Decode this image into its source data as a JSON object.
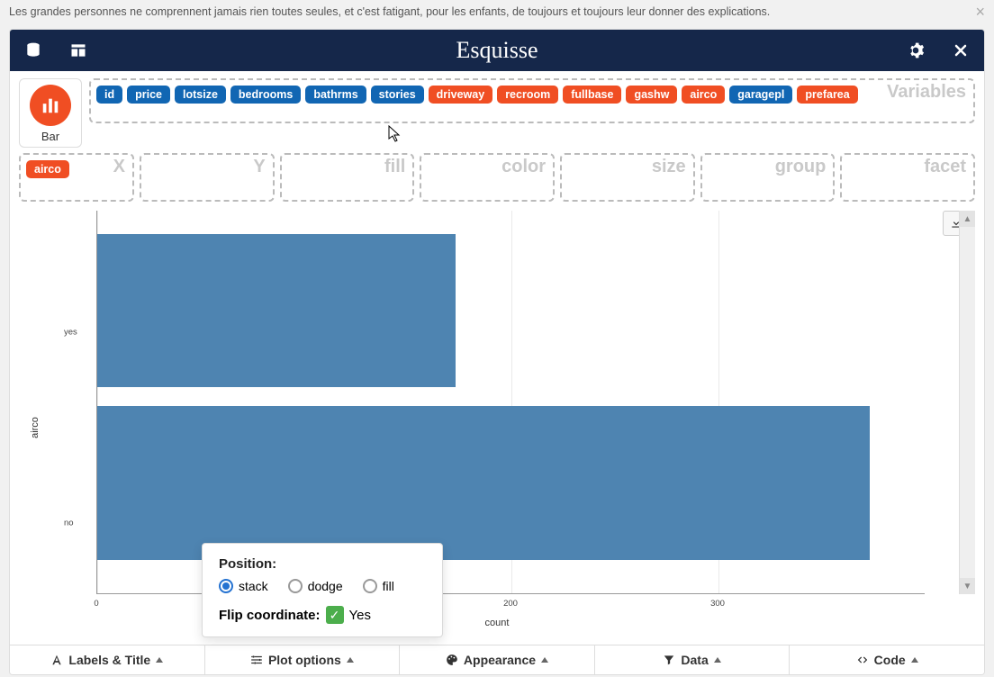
{
  "quote": "Les grandes personnes ne comprennent jamais rien toutes seules, et c'est fatigant, pour les enfants, de toujours et toujours leur donner des explications.",
  "brand": "Esquisse",
  "geom": {
    "label": "Bar"
  },
  "zones": {
    "variables_title": "Variables",
    "titles": {
      "x": "X",
      "y": "Y",
      "fill": "fill",
      "color": "color",
      "size": "size",
      "group": "group",
      "facet": "facet"
    }
  },
  "variables": [
    {
      "name": "id",
      "kind": "blue"
    },
    {
      "name": "price",
      "kind": "blue"
    },
    {
      "name": "lotsize",
      "kind": "blue"
    },
    {
      "name": "bedrooms",
      "kind": "blue"
    },
    {
      "name": "bathrms",
      "kind": "blue"
    },
    {
      "name": "stories",
      "kind": "blue"
    },
    {
      "name": "driveway",
      "kind": "orange"
    },
    {
      "name": "recroom",
      "kind": "orange"
    },
    {
      "name": "fullbase",
      "kind": "orange"
    },
    {
      "name": "gashw",
      "kind": "orange"
    },
    {
      "name": "airco",
      "kind": "orange"
    },
    {
      "name": "garagepl",
      "kind": "blue"
    },
    {
      "name": "prefarea",
      "kind": "orange"
    }
  ],
  "x_zone_pill": "airco",
  "axes": {
    "x_label": "count",
    "y_label": "airco",
    "y_ticks": [
      "yes",
      "no"
    ],
    "x_ticks": [
      "0",
      "200",
      "300"
    ]
  },
  "popup": {
    "position_label": "Position:",
    "options": [
      "stack",
      "dodge",
      "fill"
    ],
    "selected": "stack",
    "flip_label": "Flip coordinate:",
    "flip_value": "Yes"
  },
  "footer": {
    "labels": "Labels & Title",
    "plot_options": "Plot options",
    "appearance": "Appearance",
    "data": "Data",
    "code": "Code"
  },
  "chart_data": {
    "type": "bar",
    "orientation": "horizontal",
    "categories": [
      "yes",
      "no"
    ],
    "values": [
      173,
      373
    ],
    "xlabel": "count",
    "ylabel": "airco",
    "xlim": [
      0,
      400
    ]
  }
}
